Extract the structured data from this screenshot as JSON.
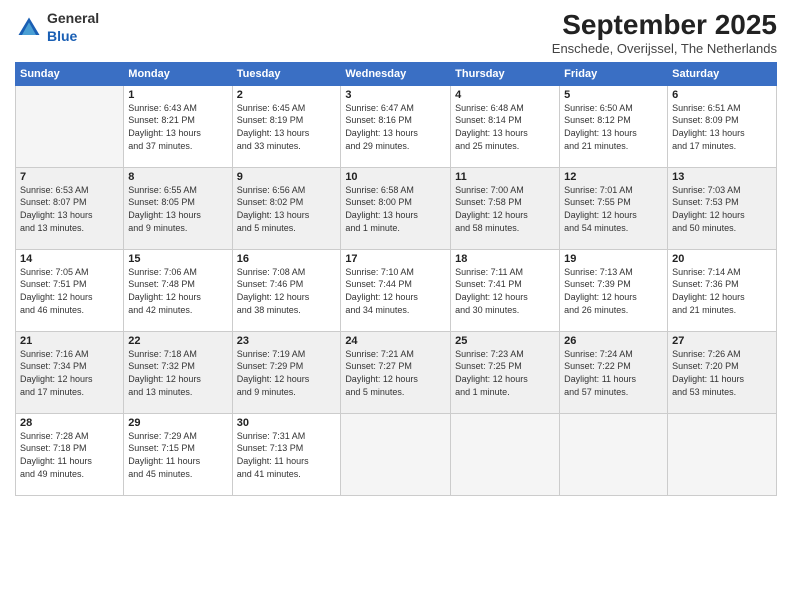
{
  "logo": {
    "general": "General",
    "blue": "Blue"
  },
  "title": "September 2025",
  "location": "Enschede, Overijssel, The Netherlands",
  "days_header": [
    "Sunday",
    "Monday",
    "Tuesday",
    "Wednesday",
    "Thursday",
    "Friday",
    "Saturday"
  ],
  "weeks": [
    [
      {
        "day": "",
        "info": ""
      },
      {
        "day": "1",
        "info": "Sunrise: 6:43 AM\nSunset: 8:21 PM\nDaylight: 13 hours\nand 37 minutes."
      },
      {
        "day": "2",
        "info": "Sunrise: 6:45 AM\nSunset: 8:19 PM\nDaylight: 13 hours\nand 33 minutes."
      },
      {
        "day": "3",
        "info": "Sunrise: 6:47 AM\nSunset: 8:16 PM\nDaylight: 13 hours\nand 29 minutes."
      },
      {
        "day": "4",
        "info": "Sunrise: 6:48 AM\nSunset: 8:14 PM\nDaylight: 13 hours\nand 25 minutes."
      },
      {
        "day": "5",
        "info": "Sunrise: 6:50 AM\nSunset: 8:12 PM\nDaylight: 13 hours\nand 21 minutes."
      },
      {
        "day": "6",
        "info": "Sunrise: 6:51 AM\nSunset: 8:09 PM\nDaylight: 13 hours\nand 17 minutes."
      }
    ],
    [
      {
        "day": "7",
        "info": "Sunrise: 6:53 AM\nSunset: 8:07 PM\nDaylight: 13 hours\nand 13 minutes."
      },
      {
        "day": "8",
        "info": "Sunrise: 6:55 AM\nSunset: 8:05 PM\nDaylight: 13 hours\nand 9 minutes."
      },
      {
        "day": "9",
        "info": "Sunrise: 6:56 AM\nSunset: 8:02 PM\nDaylight: 13 hours\nand 5 minutes."
      },
      {
        "day": "10",
        "info": "Sunrise: 6:58 AM\nSunset: 8:00 PM\nDaylight: 13 hours\nand 1 minute."
      },
      {
        "day": "11",
        "info": "Sunrise: 7:00 AM\nSunset: 7:58 PM\nDaylight: 12 hours\nand 58 minutes."
      },
      {
        "day": "12",
        "info": "Sunrise: 7:01 AM\nSunset: 7:55 PM\nDaylight: 12 hours\nand 54 minutes."
      },
      {
        "day": "13",
        "info": "Sunrise: 7:03 AM\nSunset: 7:53 PM\nDaylight: 12 hours\nand 50 minutes."
      }
    ],
    [
      {
        "day": "14",
        "info": "Sunrise: 7:05 AM\nSunset: 7:51 PM\nDaylight: 12 hours\nand 46 minutes."
      },
      {
        "day": "15",
        "info": "Sunrise: 7:06 AM\nSunset: 7:48 PM\nDaylight: 12 hours\nand 42 minutes."
      },
      {
        "day": "16",
        "info": "Sunrise: 7:08 AM\nSunset: 7:46 PM\nDaylight: 12 hours\nand 38 minutes."
      },
      {
        "day": "17",
        "info": "Sunrise: 7:10 AM\nSunset: 7:44 PM\nDaylight: 12 hours\nand 34 minutes."
      },
      {
        "day": "18",
        "info": "Sunrise: 7:11 AM\nSunset: 7:41 PM\nDaylight: 12 hours\nand 30 minutes."
      },
      {
        "day": "19",
        "info": "Sunrise: 7:13 AM\nSunset: 7:39 PM\nDaylight: 12 hours\nand 26 minutes."
      },
      {
        "day": "20",
        "info": "Sunrise: 7:14 AM\nSunset: 7:36 PM\nDaylight: 12 hours\nand 21 minutes."
      }
    ],
    [
      {
        "day": "21",
        "info": "Sunrise: 7:16 AM\nSunset: 7:34 PM\nDaylight: 12 hours\nand 17 minutes."
      },
      {
        "day": "22",
        "info": "Sunrise: 7:18 AM\nSunset: 7:32 PM\nDaylight: 12 hours\nand 13 minutes."
      },
      {
        "day": "23",
        "info": "Sunrise: 7:19 AM\nSunset: 7:29 PM\nDaylight: 12 hours\nand 9 minutes."
      },
      {
        "day": "24",
        "info": "Sunrise: 7:21 AM\nSunset: 7:27 PM\nDaylight: 12 hours\nand 5 minutes."
      },
      {
        "day": "25",
        "info": "Sunrise: 7:23 AM\nSunset: 7:25 PM\nDaylight: 12 hours\nand 1 minute."
      },
      {
        "day": "26",
        "info": "Sunrise: 7:24 AM\nSunset: 7:22 PM\nDaylight: 11 hours\nand 57 minutes."
      },
      {
        "day": "27",
        "info": "Sunrise: 7:26 AM\nSunset: 7:20 PM\nDaylight: 11 hours\nand 53 minutes."
      }
    ],
    [
      {
        "day": "28",
        "info": "Sunrise: 7:28 AM\nSunset: 7:18 PM\nDaylight: 11 hours\nand 49 minutes."
      },
      {
        "day": "29",
        "info": "Sunrise: 7:29 AM\nSunset: 7:15 PM\nDaylight: 11 hours\nand 45 minutes."
      },
      {
        "day": "30",
        "info": "Sunrise: 7:31 AM\nSunset: 7:13 PM\nDaylight: 11 hours\nand 41 minutes."
      },
      {
        "day": "",
        "info": ""
      },
      {
        "day": "",
        "info": ""
      },
      {
        "day": "",
        "info": ""
      },
      {
        "day": "",
        "info": ""
      }
    ]
  ]
}
